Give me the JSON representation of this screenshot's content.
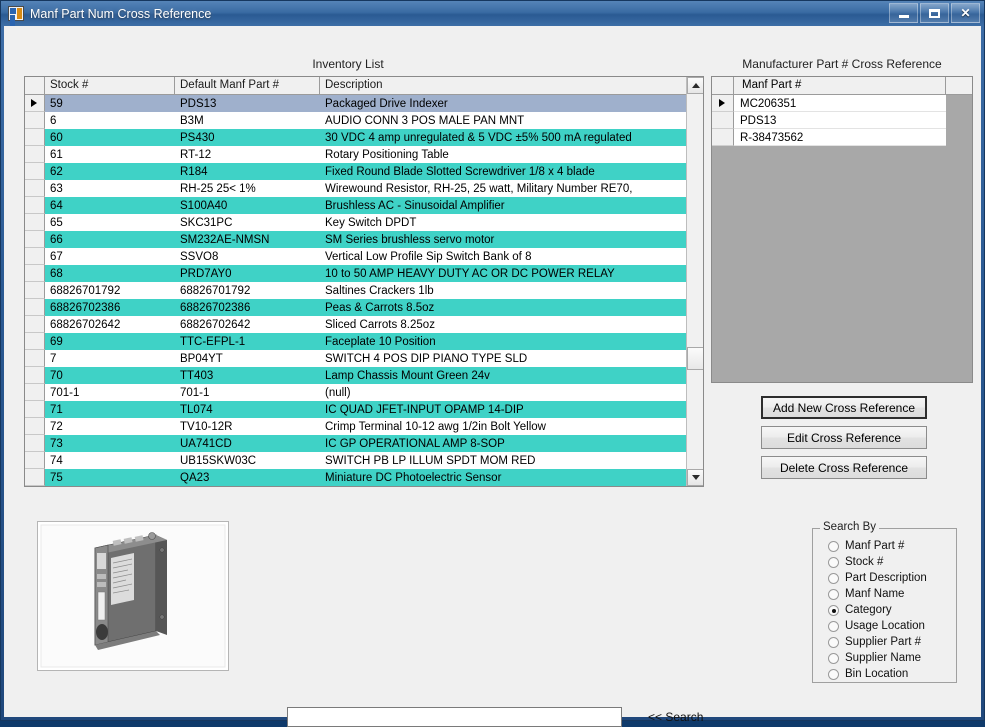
{
  "window": {
    "title": "Manf Part Num Cross Reference",
    "icon": "application-form-icon",
    "controls": {
      "minimize": "Minimize",
      "maximize": "Maximize",
      "close": "Close"
    }
  },
  "inventory": {
    "label": "Inventory List",
    "columns": [
      "Stock #",
      "Default Manf Part #",
      "Description"
    ],
    "rows": [
      {
        "stock": "59",
        "manf": "PDS13",
        "desc": "Packaged Drive Indexer",
        "style": "current"
      },
      {
        "stock": "6",
        "manf": "B3M",
        "desc": "AUDIO CONN 3 POS MALE PAN MNT",
        "style": "plain"
      },
      {
        "stock": "60",
        "manf": "PS430",
        "desc": "30 VDC 4 amp unregulated & 5 VDC ±5% 500 mA regulated",
        "style": "alt"
      },
      {
        "stock": "61",
        "manf": "RT-12",
        "desc": "Rotary Positioning Table",
        "style": "plain"
      },
      {
        "stock": "62",
        "manf": "R184",
        "desc": "Fixed Round Blade Slotted Screwdriver 1/8 x 4  blade",
        "style": "alt"
      },
      {
        "stock": "63",
        "manf": "RH-25 25< 1%",
        "desc": "Wirewound Resistor, RH-25, 25 watt, Military Number RE70,",
        "style": "plain"
      },
      {
        "stock": "64",
        "manf": "S100A40",
        "desc": "Brushless AC - Sinusoidal Amplifier",
        "style": "alt"
      },
      {
        "stock": "65",
        "manf": "SKC31PC",
        "desc": "Key Switch DPDT",
        "style": "plain"
      },
      {
        "stock": "66",
        "manf": "SM232AE-NMSN",
        "desc": "SM Series brushless servo motor",
        "style": "alt"
      },
      {
        "stock": "67",
        "manf": "SSVO8",
        "desc": "Vertical Low Profile Sip Switch Bank of 8",
        "style": "plain"
      },
      {
        "stock": "68",
        "manf": "PRD7AY0",
        "desc": "10 to 50 AMP HEAVY DUTY AC OR DC POWER RELAY",
        "style": "alt"
      },
      {
        "stock": "68826701792",
        "manf": "68826701792",
        "desc": "Saltines Crackers 1lb",
        "style": "plain"
      },
      {
        "stock": "68826702386",
        "manf": "68826702386",
        "desc": "Peas & Carrots 8.5oz",
        "style": "alt"
      },
      {
        "stock": "68826702642",
        "manf": "68826702642",
        "desc": "Sliced Carrots 8.25oz",
        "style": "plain"
      },
      {
        "stock": "69",
        "manf": "TTC-EFPL-1",
        "desc": "Faceplate  10 Position",
        "style": "alt"
      },
      {
        "stock": "7",
        "manf": "BP04YT",
        "desc": "SWITCH 4 POS DIP PIANO TYPE SLD",
        "style": "plain"
      },
      {
        "stock": "70",
        "manf": "TT403",
        "desc": "Lamp Chassis Mount Green 24v",
        "style": "alt"
      },
      {
        "stock": "701-1",
        "manf": "701-1",
        "desc": "(null)",
        "style": "plain"
      },
      {
        "stock": "71",
        "manf": "TL074",
        "desc": "IC QUAD JFET-INPUT OPAMP 14-DIP",
        "style": "alt"
      },
      {
        "stock": "72",
        "manf": "TV10-12R",
        "desc": "Crimp Terminal 10-12 awg 1/2in Bolt Yellow",
        "style": "plain"
      },
      {
        "stock": "73",
        "manf": "UA741CD",
        "desc": "IC GP OPERATIONAL AMP 8-SOP",
        "style": "alt"
      },
      {
        "stock": "74",
        "manf": "UB15SKW03C",
        "desc": "SWITCH PB LP ILLUM SPDT MOM RED",
        "style": "plain"
      },
      {
        "stock": "75",
        "manf": "QA23",
        "desc": "Miniature DC Photoelectric Sensor",
        "style": "alt"
      }
    ],
    "scrollbar": {
      "up_arrow": "scroll-up-icon",
      "down_arrow": "scroll-down-icon"
    }
  },
  "crossref": {
    "label": "Manufacturer Part # Cross Reference",
    "columns": [
      "Manf Part #"
    ],
    "rows": [
      {
        "part": "MC206351",
        "style": "current"
      },
      {
        "part": "PDS13",
        "style": "plain"
      },
      {
        "part": "R-38473562",
        "style": "plain"
      }
    ],
    "buttons": {
      "add": "Add New Cross Reference",
      "edit": "Edit Cross Reference",
      "delete": "Delete Cross Reference"
    }
  },
  "picture": {
    "name": "part-photo",
    "alt": "Servo drive amplifier module photograph"
  },
  "search_by": {
    "legend": "Search By",
    "options": [
      {
        "label": "Manf Part #",
        "checked": false
      },
      {
        "label": "Stock #",
        "checked": false
      },
      {
        "label": "Part Description",
        "checked": false
      },
      {
        "label": "Manf Name",
        "checked": false
      },
      {
        "label": "Category",
        "checked": true
      },
      {
        "label": "Usage Location",
        "checked": false
      },
      {
        "label": "Supplier Part #",
        "checked": false
      },
      {
        "label": "Supplier Name",
        "checked": false
      },
      {
        "label": "Bin Location",
        "checked": false
      }
    ]
  },
  "search": {
    "value": "",
    "placeholder": "",
    "link_label": "<< Search"
  },
  "colors": {
    "row_alt": "#3fd2c6",
    "row_selected": "#9fb0cc",
    "titlebar": "#2b5a93",
    "client_bg": "#f0f0f0",
    "grid_empty_bg": "#a8a8a8"
  }
}
